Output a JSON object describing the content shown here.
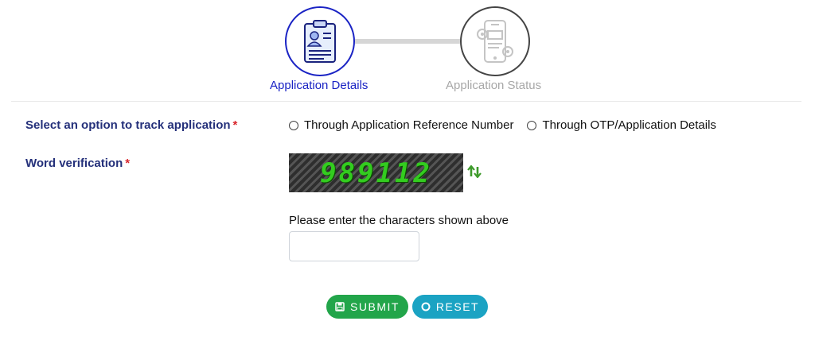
{
  "stepper": {
    "steps": [
      {
        "label": "Application Details",
        "icon": "clipboard-id-icon",
        "state": "active"
      },
      {
        "label": "Application Status",
        "icon": "device-gear-icon",
        "state": "inactive"
      }
    ]
  },
  "form": {
    "track_option": {
      "label": "Select an option to track application",
      "required": "*",
      "options": [
        "Through Application Reference Number",
        "Through OTP/Application Details"
      ]
    },
    "word_verification": {
      "label": "Word verification",
      "required": "*",
      "captcha_text": "989112",
      "refresh_icon": "refresh-icon",
      "prompt": "Please enter the characters shown above",
      "input_value": "",
      "input_placeholder": ""
    }
  },
  "actions": {
    "submit_label": "SUBMIT",
    "submit_icon": "save-icon",
    "reset_label": "RESET",
    "reset_icon": "circle-icon"
  },
  "colors": {
    "active_step": "#1a23c4",
    "label_text": "#24307a",
    "required": "#d9262c",
    "captcha_text": "#33cc1f",
    "submit_button": "#22a54a",
    "reset_button": "#1ba3c3"
  }
}
